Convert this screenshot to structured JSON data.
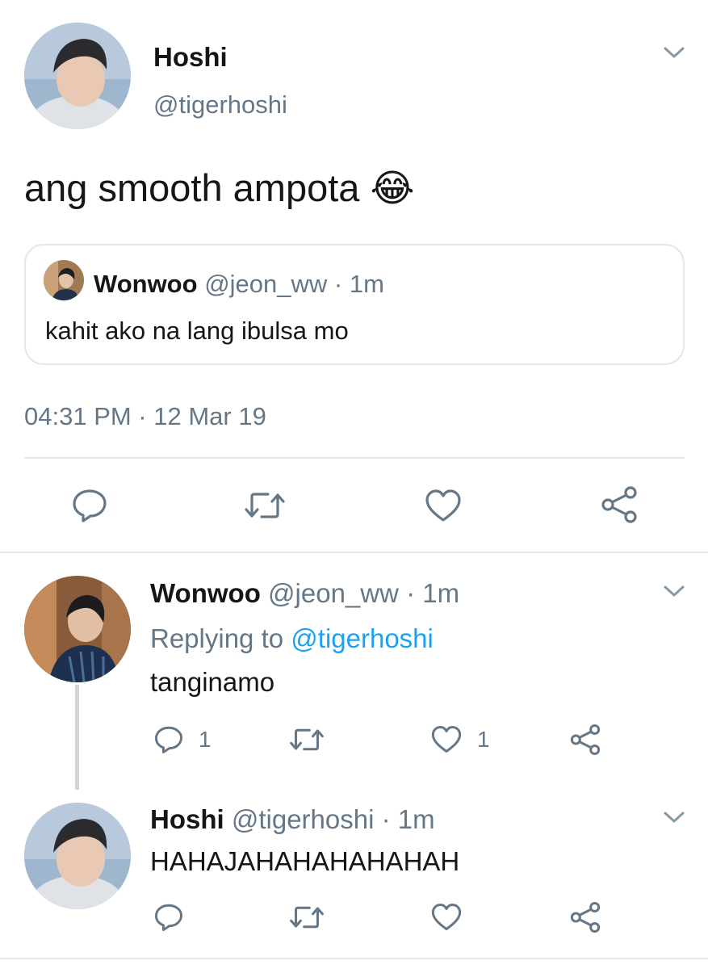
{
  "main_tweet": {
    "display_name": "Hoshi",
    "handle": "@tigerhoshi",
    "text": "ang smooth ampota",
    "emoji": "😂",
    "timestamp": "04:31 PM · 12 Mar 19",
    "quoted": {
      "display_name": "Wonwoo",
      "handle": "@jeon_ww",
      "sep": "·",
      "time": "1m",
      "text": "kahit ako na lang ibulsa mo"
    }
  },
  "reply1": {
    "display_name": "Wonwoo",
    "handle": "@jeon_ww",
    "sep": "·",
    "time": "1m",
    "replying_prefix": "Replying to",
    "replying_handle": "@tigerhoshi",
    "text": "tanginamo",
    "reply_count": "1",
    "like_count": "1"
  },
  "reply2": {
    "display_name": "Hoshi",
    "handle": "@tigerhoshi",
    "sep": "·",
    "time": "1m",
    "text": "HAHAJAHAHAHAHAHAH"
  },
  "icons": [
    "chevron-down-icon",
    "reply-icon",
    "retweet-icon",
    "like-icon",
    "share-icon"
  ],
  "colors": {
    "text": "#14171a",
    "secondary": "#657786",
    "link": "#1da1f2",
    "divider": "#e1e8ed",
    "thread_line": "#ccd6dd"
  }
}
